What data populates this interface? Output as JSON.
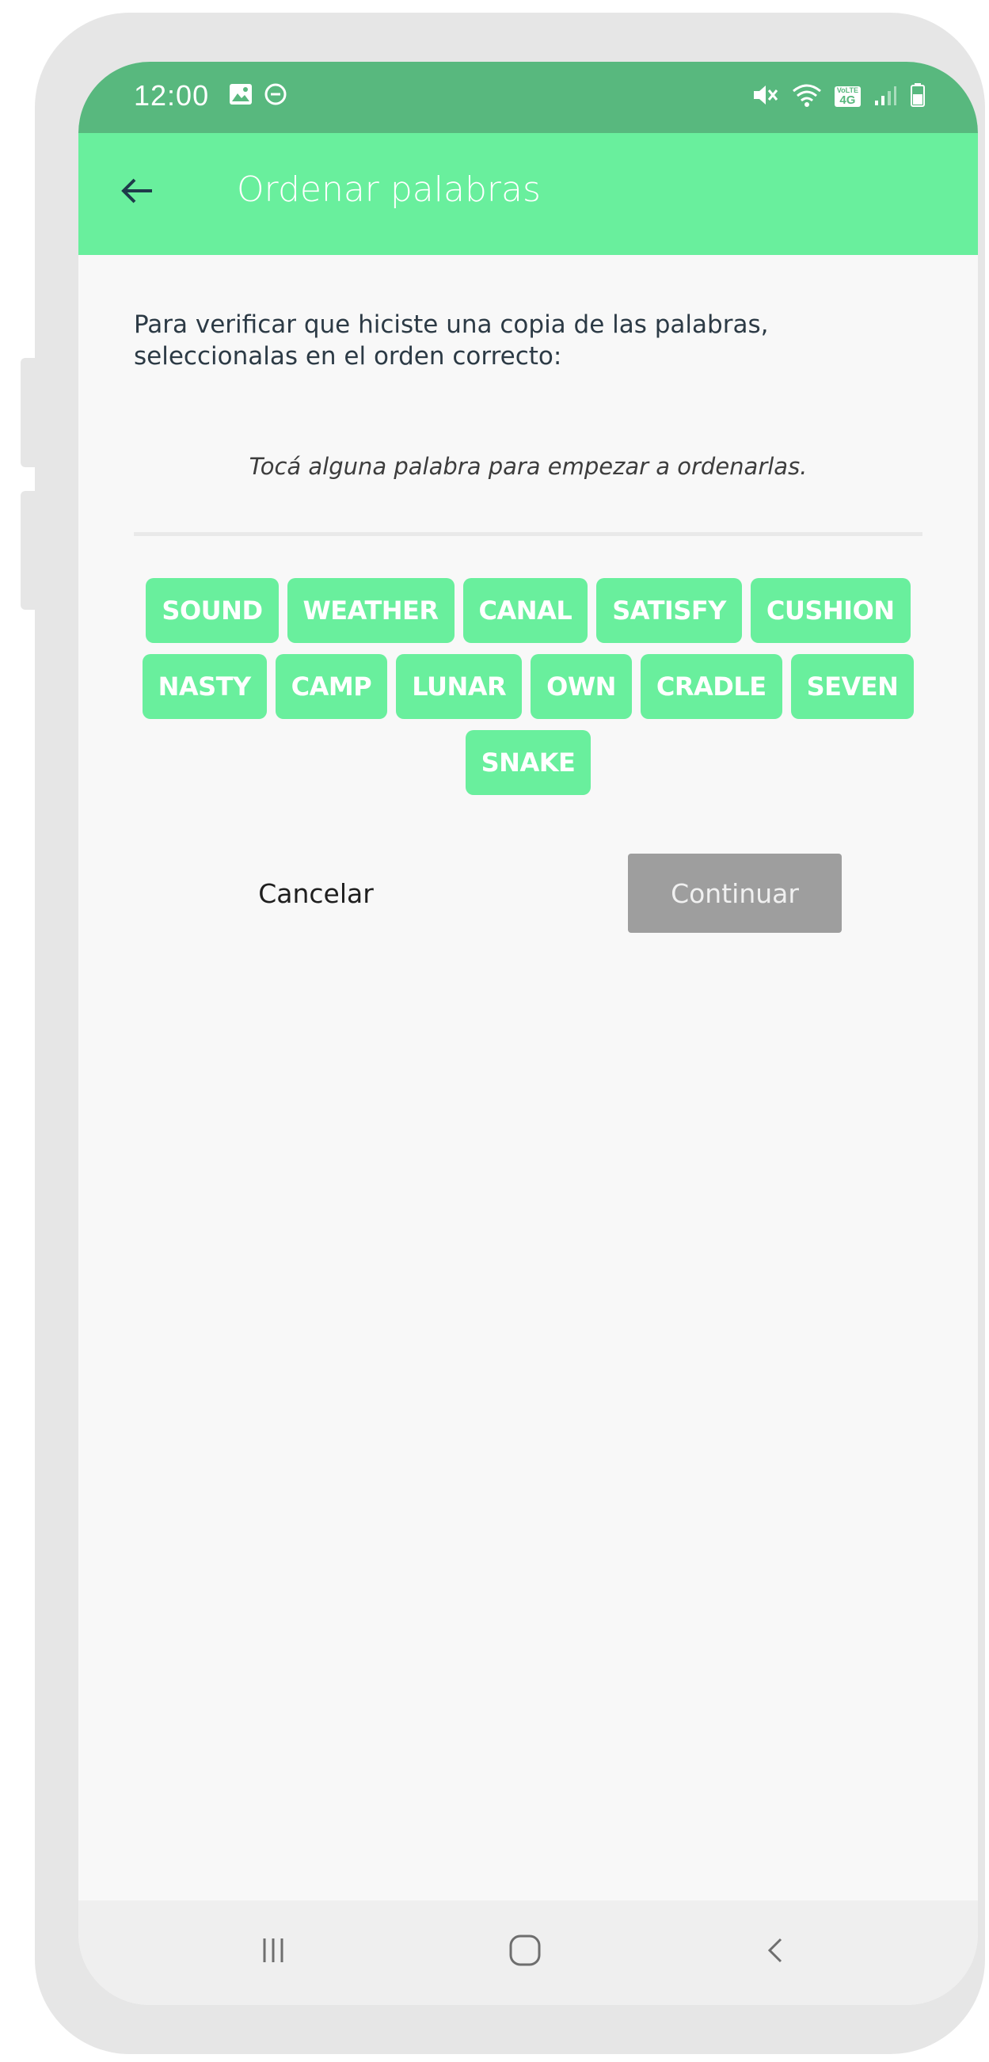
{
  "status_bar": {
    "time": "12:00",
    "left_icons": [
      "image-icon",
      "do-not-disturb-icon"
    ],
    "right_icons": [
      "mute-icon",
      "wifi-icon",
      "volte-4g-icon",
      "signal-icon",
      "battery-icon"
    ],
    "volte_label": "VoLTE",
    "lte_label": "4G"
  },
  "app_bar": {
    "back_icon": "arrow-left-icon",
    "title": "Ordenar palabras"
  },
  "content": {
    "instruction": "Para verificar que hiciste una copia de las palabras, seleccionalas en el orden correcto:",
    "hint": "Tocá alguna palabra para empezar a ordenarlas.",
    "words": [
      [
        "SOUND",
        "WEATHER",
        "CANAL",
        "SATISFY",
        "CUSHION"
      ],
      [
        "NASTY",
        "CAMP",
        "LUNAR",
        "OWN",
        "CRADLE",
        "SEVEN"
      ],
      [
        "SNAKE"
      ]
    ]
  },
  "actions": {
    "cancel_label": "Cancelar",
    "continue_label": "Continuar"
  },
  "nav_bar": {
    "icons": [
      "recent-apps-icon",
      "home-icon",
      "back-nav-icon"
    ]
  },
  "colors": {
    "status_bar": "#58b87e",
    "accent": "#69ef9d",
    "disabled_button": "#9e9e9e",
    "frame": "#e6e6e6"
  }
}
